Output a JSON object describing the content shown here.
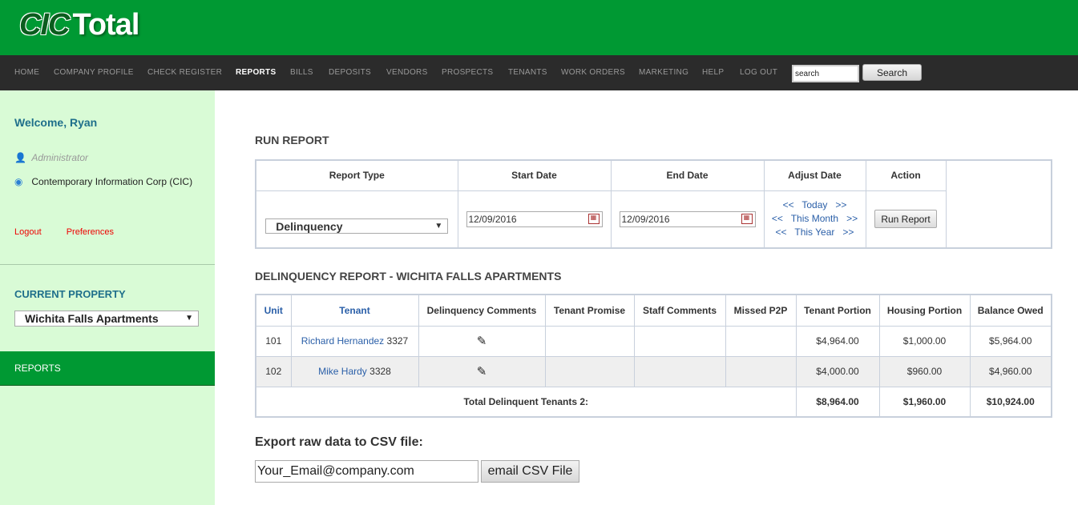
{
  "header": {
    "logo_left": "CIC",
    "logo_right": "Total"
  },
  "nav": {
    "items": [
      "HOME",
      "COMPANY PROFILE",
      "CHECK REGISTER",
      "REPORTS",
      "BILLS",
      "DEPOSITS",
      "VENDORS",
      "PROSPECTS",
      "TENANTS",
      "WORK ORDERS",
      "MARKETING",
      "HELP",
      "LOG OUT"
    ],
    "active": "REPORTS",
    "search_value": "search",
    "search_button": "Search"
  },
  "sidebar": {
    "welcome": "Welcome, Ryan",
    "role": "Administrator",
    "company": "Contemporary Information Corp (CIC)",
    "logout": "Logout",
    "preferences": "Preferences",
    "current_property_label": "CURRENT PROPERTY",
    "current_property": "Wichita Falls Apartments",
    "section": "REPORTS"
  },
  "run_report": {
    "title": "RUN REPORT",
    "headers": [
      "Report Type",
      "Start Date",
      "End Date",
      "Adjust Date",
      "Action"
    ],
    "report_type": "Delinquency",
    "start_date": "12/09/2016",
    "end_date": "12/09/2016",
    "adjust": [
      {
        "prev": "<<",
        "label": "Today",
        "next": ">>"
      },
      {
        "prev": "<<",
        "label": "This Month",
        "next": ">>"
      },
      {
        "prev": "<<",
        "label": "This Year",
        "next": ">>"
      }
    ],
    "action_button": "Run Report"
  },
  "report": {
    "title": "DELINQUENCY REPORT - WICHITA FALLS APARTMENTS",
    "headers": [
      "Unit",
      "Tenant",
      "Delinquency Comments",
      "Tenant Promise",
      "Staff Comments",
      "Missed P2P",
      "Tenant Portion",
      "Housing Portion",
      "Balance Owed"
    ],
    "rows": [
      {
        "unit": "101",
        "tenant_name": "Richard Hernandez",
        "tenant_id": "3327",
        "tenant_portion": "$4,964.00",
        "housing_portion": "$1,000.00",
        "balance": "$5,964.00"
      },
      {
        "unit": "102",
        "tenant_name": "Mike Hardy",
        "tenant_id": "3328",
        "tenant_portion": "$4,000.00",
        "housing_portion": "$960.00",
        "balance": "$4,960.00"
      }
    ],
    "total_label": "Total Delinquent Tenants 2:",
    "total_tenant_portion": "$8,964.00",
    "total_housing_portion": "$1,960.00",
    "total_balance": "$10,924.00"
  },
  "export": {
    "title": "Export raw data to CSV file:",
    "email_value": "Your_Email@company.com",
    "button": "email CSV File"
  }
}
